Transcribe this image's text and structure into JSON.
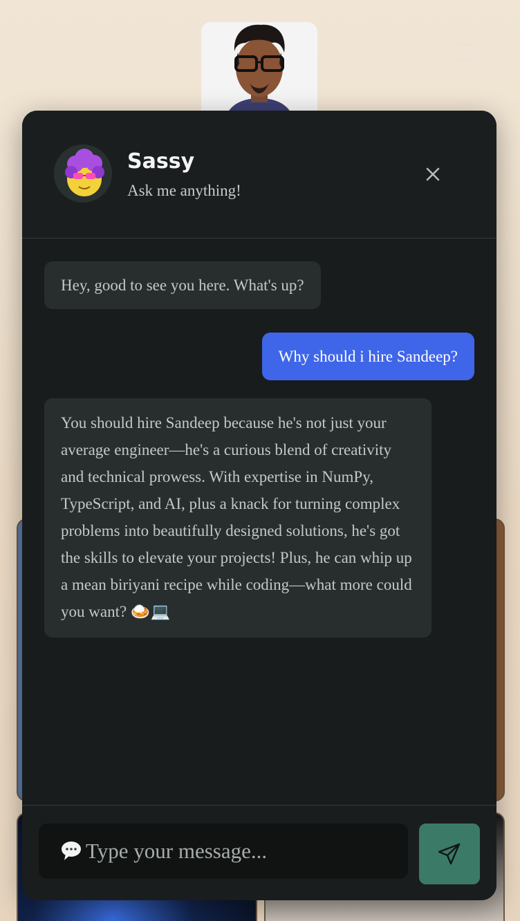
{
  "header": {
    "bot_name": "Sassy",
    "bot_subtitle": "Ask me anything!",
    "close_icon": "close-icon"
  },
  "messages": [
    {
      "sender": "bot",
      "text": "Hey, good to see you here. What's up?"
    },
    {
      "sender": "user",
      "text": "Why should i hire Sandeep?"
    },
    {
      "sender": "bot",
      "text": "You should hire Sandeep because he's not just your average engineer—he's a curious blend of creativity and technical prowess. With expertise in NumPy, TypeScript, and AI, plus a knack for turning complex problems into beautifully designed solutions, he's got the skills to elevate your projects! Plus, he can whip up a mean biriyani recipe while coding—what more could you want? 🍛💻"
    }
  ],
  "composer": {
    "placeholder": "Type your message...",
    "icon": "speech-bubble-icon",
    "send_icon": "send-icon"
  },
  "colors": {
    "panel_bg": "#191c1c",
    "user_bubble": "#3f66e8",
    "bot_bubble": "#282e2e",
    "send_button": "#3b7a67",
    "page_bg": "#f1e6d6"
  }
}
